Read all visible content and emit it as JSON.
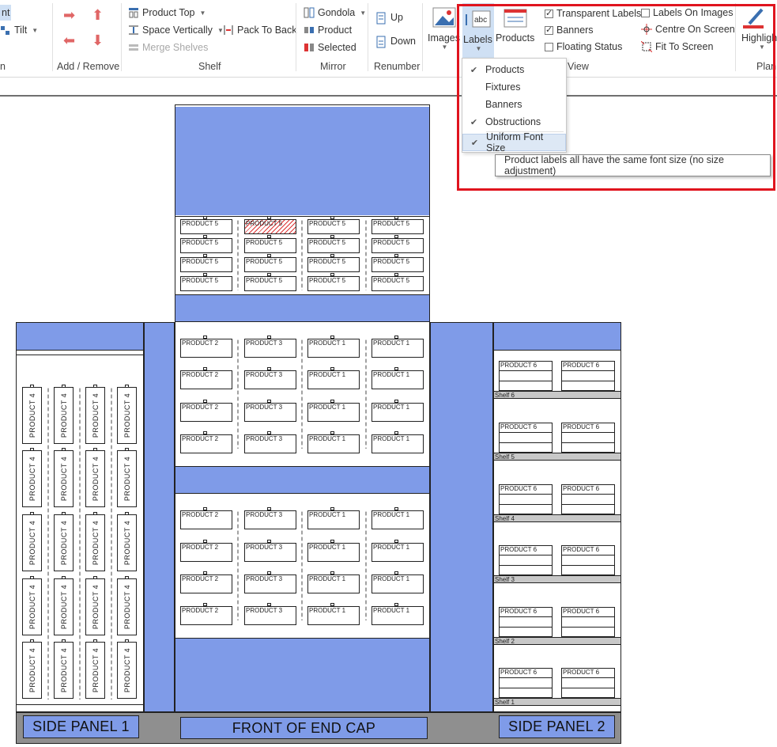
{
  "ribbon": {
    "partial_left": {
      "top_label": "nt",
      "tilt": "Tilt",
      "group_label": "n"
    },
    "add_remove": {
      "group_label": "Add / Remove"
    },
    "shelf": {
      "product_top": "Product Top",
      "space_vertically": "Space Vertically",
      "pack_to_back": "Pack To Back",
      "merge_shelves": "Merge Shelves",
      "group_label": "Shelf"
    },
    "mirror": {
      "gondola": "Gondola",
      "product": "Product",
      "selected": "Selected",
      "group_label": "Mirror"
    },
    "renumber": {
      "up": "Up",
      "down": "Down",
      "group_label": "Renumber"
    },
    "view": {
      "images": "Images",
      "labels": "Labels",
      "products": "Products",
      "transparent_labels": {
        "label": "Transparent Labels",
        "checked": true
      },
      "banners": {
        "label": "Banners",
        "checked": true
      },
      "floating_status": {
        "label": "Floating Status",
        "checked": false
      },
      "labels_on_images": {
        "label": "Labels On Images",
        "checked": false
      },
      "centre_on_screen": "Centre On Screen",
      "fit_to_screen": "Fit To Screen",
      "group_label": "View"
    },
    "highlight": {
      "label": "Highligh",
      "group_label": "Plan"
    }
  },
  "labels_menu": {
    "items": [
      {
        "label": "Products",
        "checked": true
      },
      {
        "label": "Fixtures",
        "checked": false
      },
      {
        "label": "Banners",
        "checked": false
      },
      {
        "label": "Obstructions",
        "checked": true
      },
      {
        "label": "Uniform Font Size",
        "checked": true,
        "highlighted": true
      }
    ]
  },
  "tooltip": {
    "text": "Product labels all have the same font size (no size adjustment)"
  },
  "planogram": {
    "top_section_rows": [
      [
        "PRODUCT 5",
        "PRODUCT 5",
        "PRODUCT 5",
        "PRODUCT 5"
      ],
      [
        "PRODUCT 5",
        "PRODUCT 5",
        "PRODUCT 5",
        "PRODUCT 5"
      ],
      [
        "PRODUCT 5",
        "PRODUCT 5",
        "PRODUCT 5",
        "PRODUCT 5"
      ],
      [
        "PRODUCT 5",
        "PRODUCT 5",
        "PRODUCT 5",
        "PRODUCT 5"
      ]
    ],
    "middle_section_rows": [
      [
        "PRODUCT 2",
        "PRODUCT 3",
        "PRODUCT 1",
        "PRODUCT 1"
      ],
      [
        "PRODUCT 2",
        "PRODUCT 3",
        "PRODUCT 1",
        "PRODUCT 1"
      ],
      [
        "PRODUCT 2",
        "PRODUCT 3",
        "PRODUCT 1",
        "PRODUCT 1"
      ],
      [
        "PRODUCT 2",
        "PRODUCT 3",
        "PRODUCT 1",
        "PRODUCT 1"
      ]
    ],
    "bottom_section_rows": [
      [
        "PRODUCT 2",
        "PRODUCT 3",
        "PRODUCT 1",
        "PRODUCT 1"
      ],
      [
        "PRODUCT 2",
        "PRODUCT 3",
        "PRODUCT 1",
        "PRODUCT 1"
      ],
      [
        "PRODUCT 2",
        "PRODUCT 3",
        "PRODUCT 1",
        "PRODUCT 1"
      ],
      [
        "PRODUCT 2",
        "PRODUCT 3",
        "PRODUCT 1",
        "PRODUCT 1"
      ]
    ],
    "side_panel_1_product": "PRODUCT 4",
    "side_panel_2_product": "PRODUCT 6",
    "side_panel_2_shelves": [
      "Shelf 6",
      "Shelf 5",
      "Shelf 4",
      "Shelf 3",
      "Shelf 2",
      "Shelf 1"
    ],
    "base_labels": {
      "side_panel_1": "SIDE PANEL 1",
      "front": "FRONT OF END CAP",
      "side_panel_2": "SIDE PANEL 2"
    }
  }
}
